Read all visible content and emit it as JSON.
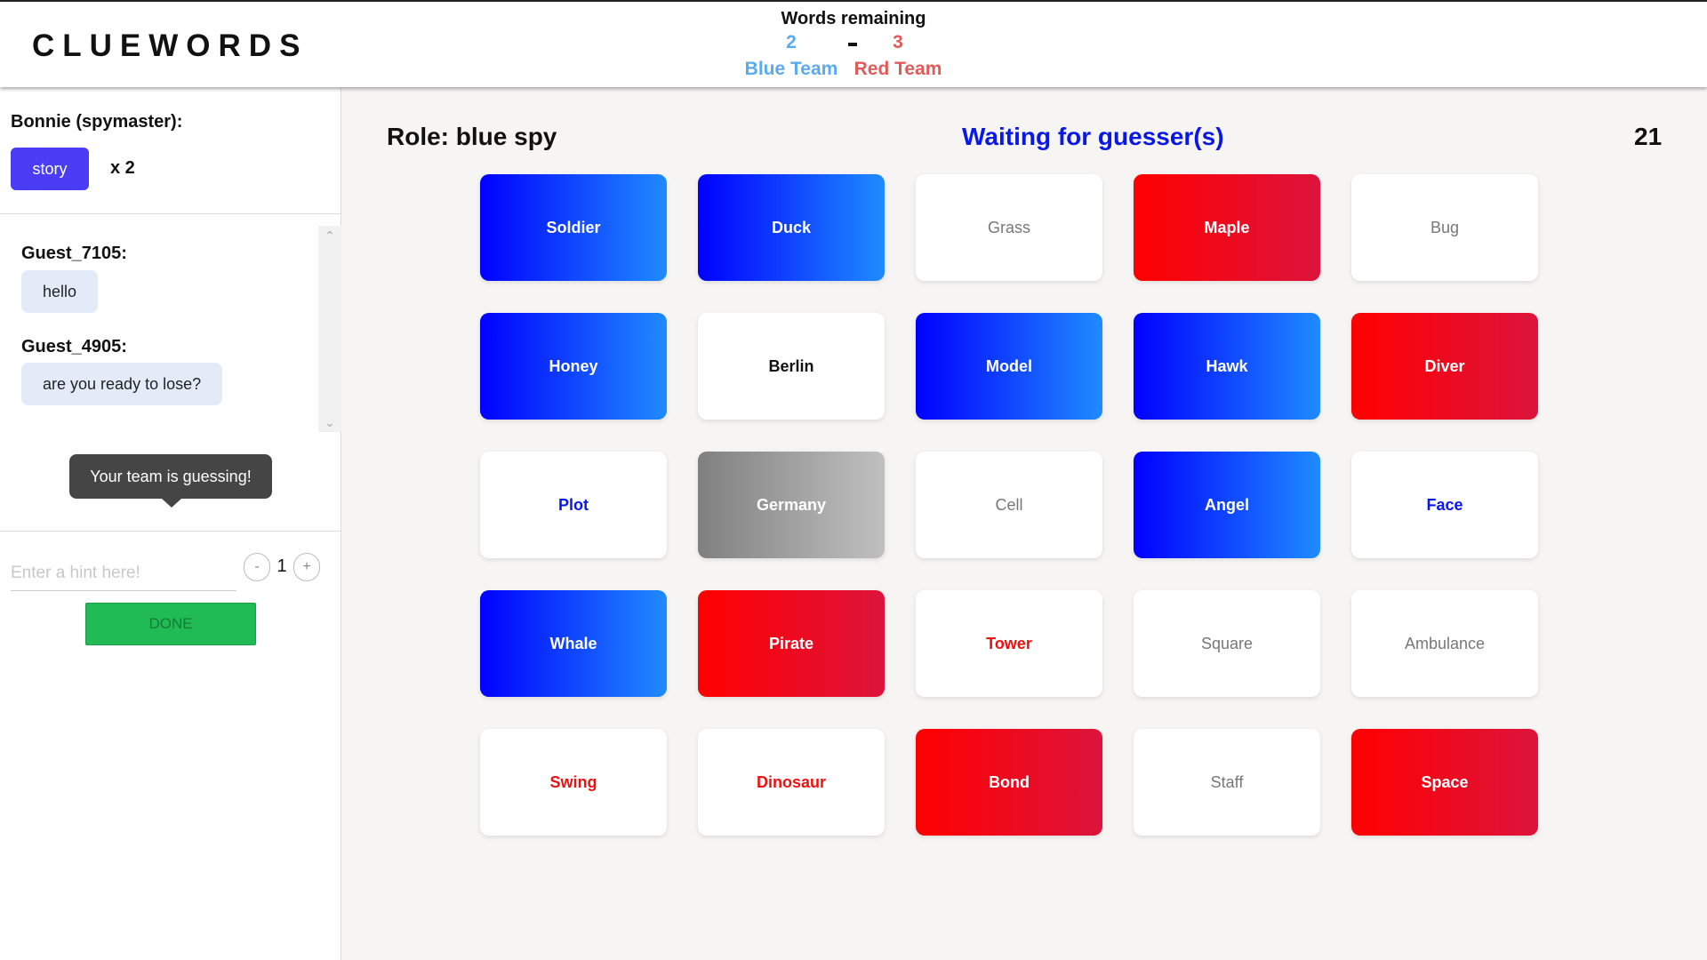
{
  "header": {
    "logo": "CLUEWORDS",
    "score_title": "Words remaining",
    "blue_count": "2",
    "red_count": "3",
    "blue_team_label": "Blue Team",
    "red_team_label": "Red Team"
  },
  "sidebar": {
    "spymaster_label": "Bonnie (spymaster):",
    "hint_word": "story",
    "hint_count": "x 2",
    "chat": [
      {
        "author": "Guest_7105:",
        "message": "hello"
      },
      {
        "author": "Guest_4905:",
        "message": "are you ready to lose?"
      }
    ],
    "tooltip": "Your team is guessing!",
    "hint_input_placeholder": "Enter a hint here!",
    "stepper_minus": "-",
    "stepper_value": "1",
    "stepper_plus": "+",
    "done_label": "DONE"
  },
  "main": {
    "role": "Role: blue spy",
    "status": "Waiting for guesser(s)",
    "timer": "21"
  },
  "colors": {
    "blue_team": "#5aaaf0",
    "red_team": "#e05a5a",
    "hint_chip": "#4b3cf5",
    "done_button": "#21bb55",
    "status_text": "#0a18e6"
  },
  "cards": [
    {
      "word": "Soldier",
      "style": "blue"
    },
    {
      "word": "Duck",
      "style": "blue"
    },
    {
      "word": "Grass",
      "style": "plain text-gray"
    },
    {
      "word": "Maple",
      "style": "red"
    },
    {
      "word": "Bug",
      "style": "plain text-gray"
    },
    {
      "word": "Honey",
      "style": "blue"
    },
    {
      "word": "Berlin",
      "style": "plain text-black"
    },
    {
      "word": "Model",
      "style": "blue"
    },
    {
      "word": "Hawk",
      "style": "blue"
    },
    {
      "word": "Diver",
      "style": "red"
    },
    {
      "word": "Plot",
      "style": "plain text-blue"
    },
    {
      "word": "Germany",
      "style": "assassin"
    },
    {
      "word": "Cell",
      "style": "plain text-gray"
    },
    {
      "word": "Angel",
      "style": "blue"
    },
    {
      "word": "Face",
      "style": "plain text-blue"
    },
    {
      "word": "Whale",
      "style": "blue"
    },
    {
      "word": "Pirate",
      "style": "red"
    },
    {
      "word": "Tower",
      "style": "plain text-red"
    },
    {
      "word": "Square",
      "style": "plain text-gray"
    },
    {
      "word": "Ambulance",
      "style": "plain text-gray"
    },
    {
      "word": "Swing",
      "style": "plain text-red"
    },
    {
      "word": "Dinosaur",
      "style": "plain text-red"
    },
    {
      "word": "Bond",
      "style": "red"
    },
    {
      "word": "Staff",
      "style": "plain text-gray"
    },
    {
      "word": "Space",
      "style": "red"
    }
  ]
}
